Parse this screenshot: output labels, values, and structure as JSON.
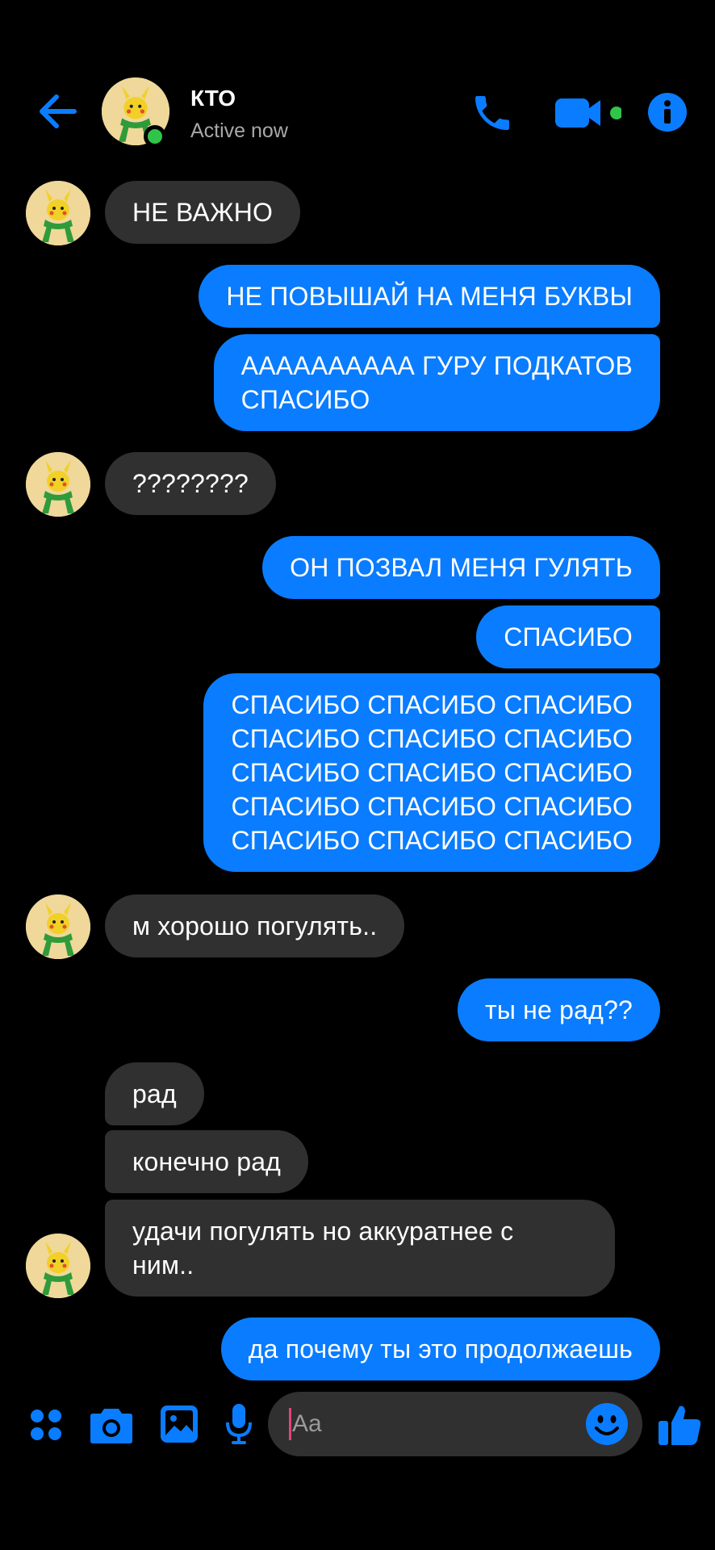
{
  "header": {
    "name": "КТО",
    "status": "Active now"
  },
  "messages": [
    {
      "from": "them",
      "text": "НЕ ВАЖНО"
    },
    {
      "from": "me",
      "text": "НЕ ПОВЫШАЙ НА МЕНЯ БУКВЫ"
    },
    {
      "from": "me",
      "text": "АААААААААА ГУРУ ПОДКАТОВ\nСПАСИБО"
    },
    {
      "from": "them",
      "text": "????????"
    },
    {
      "from": "me",
      "text": "ОН ПОЗВАЛ МЕНЯ ГУЛЯТЬ"
    },
    {
      "from": "me",
      "text": "СПАСИБО"
    },
    {
      "from": "me",
      "text": "СПАСИБО СПАСИБО СПАСИБО\nСПАСИБО СПАСИБО СПАСИБО\nСПАСИБО СПАСИБО СПАСИБО\nСПАСИБО СПАСИБО СПАСИБО\nСПАСИБО СПАСИБО СПАСИБО"
    },
    {
      "from": "them",
      "text": "м хорошо погулять.."
    },
    {
      "from": "me",
      "text": "ты не рад??"
    },
    {
      "from": "them",
      "text": "рад"
    },
    {
      "from": "them",
      "text": "конечно рад"
    },
    {
      "from": "them",
      "text": "удачи погулять но аккуратнее с\nним.."
    },
    {
      "from": "me",
      "text": "да почему ты это продолжаешь"
    }
  ],
  "composer": {
    "placeholder": "Aa"
  },
  "icons": {
    "back": "back-arrow-icon",
    "call": "phone-icon",
    "video": "video-camera-icon",
    "info": "info-icon",
    "apps": "apps-grid-icon",
    "camera": "camera-icon",
    "gallery": "image-icon",
    "mic": "microphone-icon",
    "emoji": "emoji-icon",
    "like": "thumbs-up-icon"
  },
  "colors": {
    "accent": "#0a7cff",
    "incoming_bubble": "#303030",
    "online": "#31c44a",
    "background": "#000000"
  }
}
